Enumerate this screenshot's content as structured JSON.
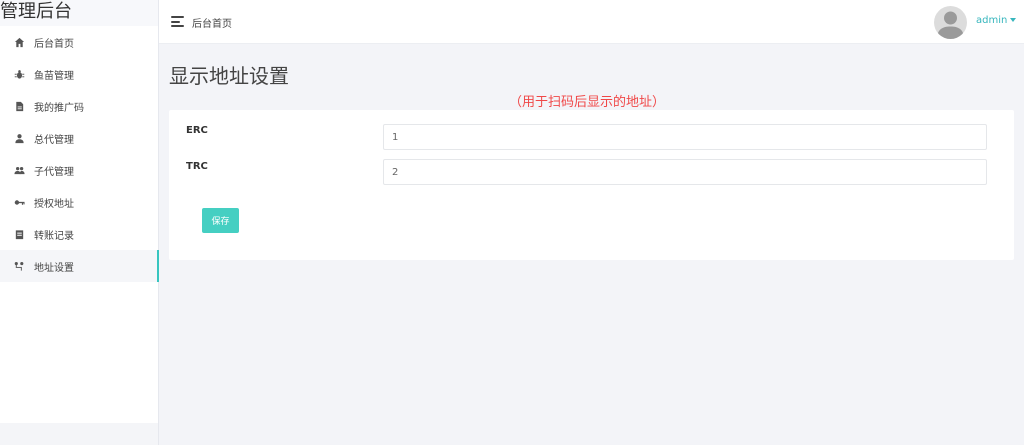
{
  "app": {
    "brand": "管理后台"
  },
  "sidebar": {
    "items": [
      {
        "label": "后台首页",
        "icon": "home-icon",
        "active": false
      },
      {
        "label": "鱼苗管理",
        "icon": "bug-icon",
        "active": false
      },
      {
        "label": "我的推广码",
        "icon": "document-icon",
        "active": false
      },
      {
        "label": "总代管理",
        "icon": "user-icon",
        "active": false
      },
      {
        "label": "子代管理",
        "icon": "users-icon",
        "active": false
      },
      {
        "label": "授权地址",
        "icon": "key-icon",
        "active": false
      },
      {
        "label": "转账记录",
        "icon": "clipboard-icon",
        "active": false
      },
      {
        "label": "地址设置",
        "icon": "settings-icon",
        "active": true
      }
    ]
  },
  "header": {
    "breadcrumb": "后台首页",
    "username": "admin"
  },
  "main": {
    "title": "显示地址设置",
    "notice": "（用于扫码后显示的地址）",
    "fields": [
      {
        "label": "ERC",
        "value": "1"
      },
      {
        "label": "TRC",
        "value": "2"
      }
    ],
    "save_label": "保存"
  },
  "colors": {
    "accent": "#37c5bf",
    "button": "#45cfc2",
    "notice": "#f04848",
    "link": "#37b6bd"
  }
}
